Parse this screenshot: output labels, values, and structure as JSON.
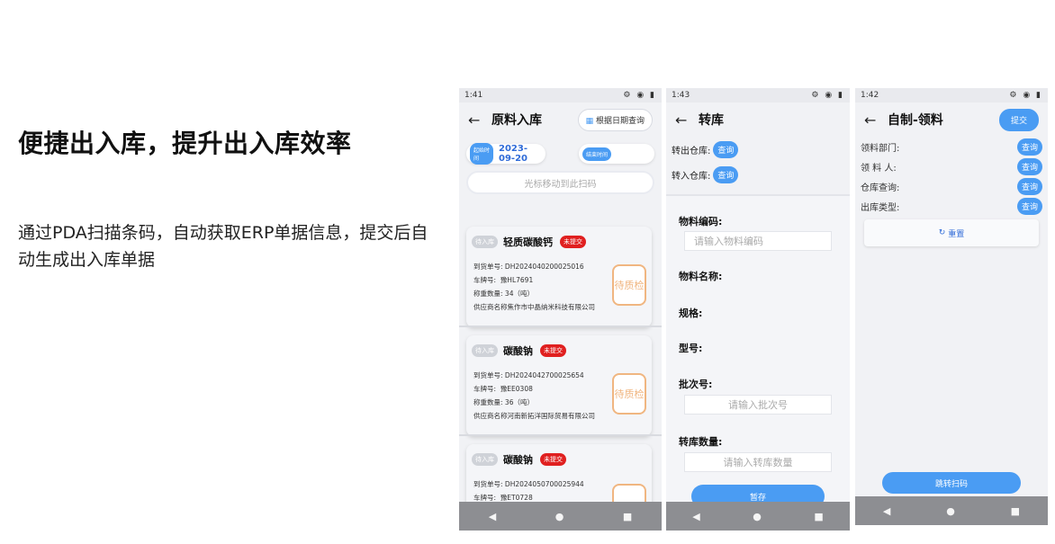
{
  "headline": "便捷出入库，提升出入库效率",
  "description": "通过PDA扫描条码，自动获取ERP单据信息，提交后自动生成出入库单据",
  "phone1": {
    "time": "1:41",
    "title": "原料入库",
    "date_query_label": "根据日期查询",
    "start_tag": "起始时间",
    "start_date": "2023-09-20",
    "end_tag": "结束时间",
    "scan_placeholder": "光标移动到此扫码",
    "cards": [
      {
        "tag": "待入库",
        "name": "轻质碳酸钙",
        "status": "未提交",
        "order_label": "到货单号:",
        "order": "DH2024040200025016",
        "plate_label": "车牌号:",
        "plate": "豫HL7691",
        "qty_label": "称重数量:",
        "qty": "34（吨）",
        "supplier_label": "供应商名称",
        "supplier": "焦作市中晶纳米科技有限公司",
        "action": "待质检"
      },
      {
        "tag": "待入库",
        "name": "碳酸钠",
        "status": "未提交",
        "order_label": "到货单号:",
        "order": "DH2024042700025654",
        "plate_label": "车牌号:",
        "plate": "豫EE0308",
        "qty_label": "称重数量:",
        "qty": "36（吨）",
        "supplier_label": "供应商名称",
        "supplier": "河南新拓洋国际贸易有限公司",
        "action": "待质检"
      },
      {
        "tag": "待入库",
        "name": "碳酸钠",
        "status": "未提交",
        "order_label": "到货单号:",
        "order": "DH2024050700025944",
        "plate_label": "车牌号:",
        "plate": "豫ET0728"
      }
    ]
  },
  "phone2": {
    "time": "1:43",
    "title": "转库",
    "out_wh_label": "转出仓库:",
    "in_wh_label": "转入仓库:",
    "query": "查询",
    "material_code_label": "物料编码:",
    "material_code_placeholder": "请输入物料编码",
    "material_name_label": "物料名称:",
    "spec_label": "规格:",
    "model_label": "型号:",
    "batch_label": "批次号:",
    "batch_placeholder": "请输入批次号",
    "qty_label": "转库数量:",
    "qty_placeholder": "请输入转库数量",
    "save_label": "暂存"
  },
  "phone3": {
    "time": "1:42",
    "title": "自制-领料",
    "submit_label": "提交",
    "query": "查询",
    "dept_label": "领料部门:",
    "person_label": "领 料 人:",
    "wh_label": "仓库查询:",
    "out_type_label": "出库类型:",
    "reset_label": "重置",
    "jump_scan_label": "跳转扫码"
  },
  "colors": {
    "accent": "#4a9cf3",
    "danger": "#e02020",
    "qc": "#f0b681"
  }
}
